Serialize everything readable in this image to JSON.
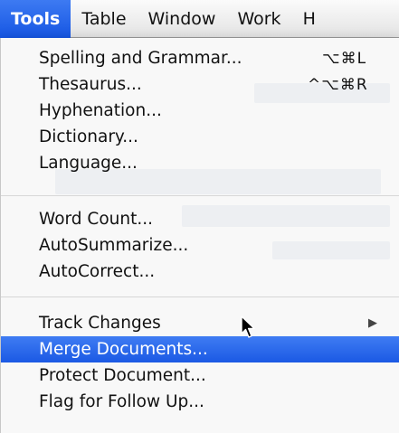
{
  "menubar": {
    "items": [
      {
        "label": "Tools"
      },
      {
        "label": "Table"
      },
      {
        "label": "Window"
      },
      {
        "label": "Work"
      },
      {
        "label": "H"
      }
    ]
  },
  "menu": {
    "groups": [
      [
        {
          "label": "Spelling and Grammar...",
          "shortcut": "⌥⌘L"
        },
        {
          "label": "Thesaurus...",
          "shortcut": "^⌥⌘R"
        },
        {
          "label": "Hyphenation..."
        },
        {
          "label": "Dictionary..."
        },
        {
          "label": "Language..."
        }
      ],
      [
        {
          "label": "Word Count..."
        },
        {
          "label": "AutoSummarize..."
        },
        {
          "label": "AutoCorrect..."
        }
      ],
      [
        {
          "label": "Track Changes",
          "submenu": "▶"
        },
        {
          "label": "Merge Documents...",
          "highlighted": true
        },
        {
          "label": "Protect Document..."
        },
        {
          "label": "Flag for Follow Up..."
        }
      ]
    ]
  },
  "colors": {
    "highlight": "#1b59e4",
    "menubar_active": "#1656e3",
    "menu_background": "#f8f8f8"
  }
}
